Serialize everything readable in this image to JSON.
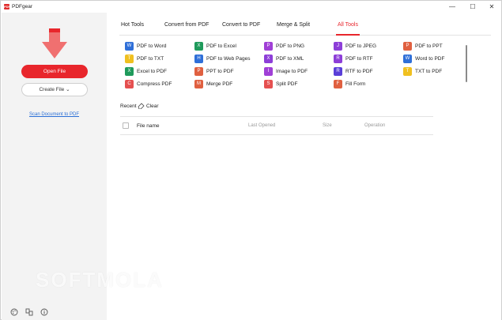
{
  "app": {
    "title": "PDFgear",
    "logo_text": "PDF"
  },
  "window_controls": {
    "minimize": "—",
    "maximize": "☐",
    "close": "✕"
  },
  "sidebar": {
    "open_file": "Open File",
    "create_file": "Create File ⌄",
    "scan_link": "Scan Document to PDF",
    "bottom_icons": [
      "palette-icon",
      "convert-icon",
      "info-icon"
    ]
  },
  "tabs": [
    {
      "label": "Hot Tools"
    },
    {
      "label": "Convert from PDF"
    },
    {
      "label": "Convert to PDF"
    },
    {
      "label": "Merge & Split"
    },
    {
      "label": "All Tools"
    }
  ],
  "tools": [
    {
      "label": "PDF to Word",
      "color": "#2f6fd8",
      "glyph": "W"
    },
    {
      "label": "PDF to Excel",
      "color": "#1f9a5b",
      "glyph": "X"
    },
    {
      "label": "PDF to PNG",
      "color": "#a03fd6",
      "glyph": "P"
    },
    {
      "label": "PDF to JPEG",
      "color": "#8d3ed8",
      "glyph": "J"
    },
    {
      "label": "PDF to PPT",
      "color": "#e06040",
      "glyph": "P"
    },
    {
      "label": "PDF to TXT",
      "color": "#f0c020",
      "glyph": "T"
    },
    {
      "label": "PDF to Web Pages",
      "color": "#2f6fd8",
      "glyph": "H"
    },
    {
      "label": "PDF to XML",
      "color": "#8d3ed8",
      "glyph": "X"
    },
    {
      "label": "PDF to RTF",
      "color": "#8d3ed8",
      "glyph": "R"
    },
    {
      "label": "Word to PDF",
      "color": "#2f6fd8",
      "glyph": "W"
    },
    {
      "label": "Excel to PDF",
      "color": "#1f9a5b",
      "glyph": "X"
    },
    {
      "label": "PPT to PDF",
      "color": "#e06040",
      "glyph": "P"
    },
    {
      "label": "Image to PDF",
      "color": "#a03fd6",
      "glyph": "I"
    },
    {
      "label": "RTF to PDF",
      "color": "#5a3fd8",
      "glyph": "R"
    },
    {
      "label": "TXT to PDF",
      "color": "#f0c020",
      "glyph": "T"
    },
    {
      "label": "Compress PDF",
      "color": "#e55050",
      "glyph": "C"
    },
    {
      "label": "Merge PDF",
      "color": "#e06040",
      "glyph": "M"
    },
    {
      "label": "Split PDF",
      "color": "#e55050",
      "glyph": "S"
    },
    {
      "label": "Fill Form",
      "color": "#e06040",
      "glyph": "F"
    }
  ],
  "recent": {
    "label": "Recent",
    "clear": "Clear"
  },
  "table": {
    "columns": [
      "File name",
      "Last Opened",
      "Size",
      "Operation"
    ]
  },
  "watermark": "SOFTMOLA"
}
